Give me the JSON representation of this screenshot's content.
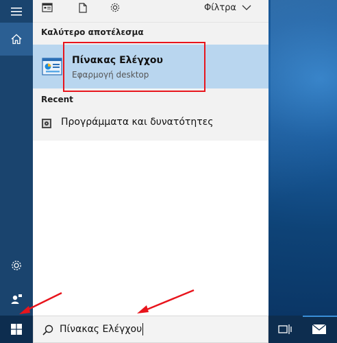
{
  "toolbar": {
    "icons": [
      "apps-icon",
      "document-icon",
      "settings-icon"
    ],
    "filters_label": "Φίλτρα"
  },
  "results": {
    "best_match_title": "Καλύτερο αποτέλεσμα",
    "best_match_name": "Πίνακας Ελέγχου",
    "best_match_type": "Εφαρμογή desktop",
    "recent_title": "Recent",
    "recent_items": [
      {
        "label": "Προγράμματα και δυνατότητες",
        "icon": "programs-icon"
      }
    ]
  },
  "search": {
    "value": "Πίνακας Ελέγχου"
  },
  "rail": {
    "icons": [
      "hamburger-menu-icon",
      "home-icon",
      "settings-icon",
      "feedback-icon"
    ]
  },
  "taskbar": {
    "icons": [
      "windows-start-icon",
      "search-icon",
      "task-view-icon",
      "mail-icon"
    ]
  },
  "colors": {
    "accent": "#b9d6ef",
    "highlight_border": "#e8141c",
    "rail": "#1a446e",
    "taskbar": "#0d2d4f"
  }
}
